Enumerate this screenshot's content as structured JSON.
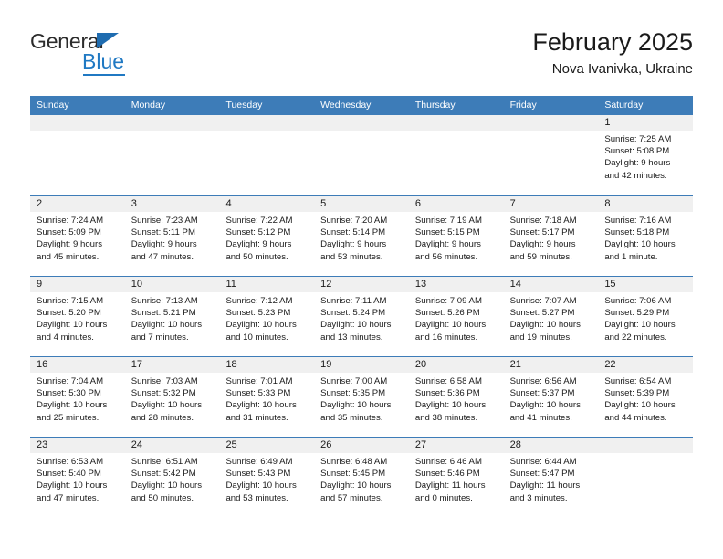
{
  "brand": {
    "name_part1": "General",
    "name_part2": "Blue",
    "triangle_color": "#1f6cb0",
    "blue_color": "#2079c3"
  },
  "header": {
    "title": "February 2025",
    "subtitle": "Nova Ivanivka, Ukraine"
  },
  "theme": {
    "header_blue": "#3d7cb8",
    "day_band_gray": "#f0f0f0",
    "text_color": "#1a1a1a"
  },
  "weekdays": [
    "Sunday",
    "Monday",
    "Tuesday",
    "Wednesday",
    "Thursday",
    "Friday",
    "Saturday"
  ],
  "weeks": [
    [
      {
        "day": "",
        "sunrise": "",
        "sunset": "",
        "daylight_line1": "",
        "daylight_line2": ""
      },
      {
        "day": "",
        "sunrise": "",
        "sunset": "",
        "daylight_line1": "",
        "daylight_line2": ""
      },
      {
        "day": "",
        "sunrise": "",
        "sunset": "",
        "daylight_line1": "",
        "daylight_line2": ""
      },
      {
        "day": "",
        "sunrise": "",
        "sunset": "",
        "daylight_line1": "",
        "daylight_line2": ""
      },
      {
        "day": "",
        "sunrise": "",
        "sunset": "",
        "daylight_line1": "",
        "daylight_line2": ""
      },
      {
        "day": "",
        "sunrise": "",
        "sunset": "",
        "daylight_line1": "",
        "daylight_line2": ""
      },
      {
        "day": "1",
        "sunrise": "Sunrise: 7:25 AM",
        "sunset": "Sunset: 5:08 PM",
        "daylight_line1": "Daylight: 9 hours",
        "daylight_line2": "and 42 minutes."
      }
    ],
    [
      {
        "day": "2",
        "sunrise": "Sunrise: 7:24 AM",
        "sunset": "Sunset: 5:09 PM",
        "daylight_line1": "Daylight: 9 hours",
        "daylight_line2": "and 45 minutes."
      },
      {
        "day": "3",
        "sunrise": "Sunrise: 7:23 AM",
        "sunset": "Sunset: 5:11 PM",
        "daylight_line1": "Daylight: 9 hours",
        "daylight_line2": "and 47 minutes."
      },
      {
        "day": "4",
        "sunrise": "Sunrise: 7:22 AM",
        "sunset": "Sunset: 5:12 PM",
        "daylight_line1": "Daylight: 9 hours",
        "daylight_line2": "and 50 minutes."
      },
      {
        "day": "5",
        "sunrise": "Sunrise: 7:20 AM",
        "sunset": "Sunset: 5:14 PM",
        "daylight_line1": "Daylight: 9 hours",
        "daylight_line2": "and 53 minutes."
      },
      {
        "day": "6",
        "sunrise": "Sunrise: 7:19 AM",
        "sunset": "Sunset: 5:15 PM",
        "daylight_line1": "Daylight: 9 hours",
        "daylight_line2": "and 56 minutes."
      },
      {
        "day": "7",
        "sunrise": "Sunrise: 7:18 AM",
        "sunset": "Sunset: 5:17 PM",
        "daylight_line1": "Daylight: 9 hours",
        "daylight_line2": "and 59 minutes."
      },
      {
        "day": "8",
        "sunrise": "Sunrise: 7:16 AM",
        "sunset": "Sunset: 5:18 PM",
        "daylight_line1": "Daylight: 10 hours",
        "daylight_line2": "and 1 minute."
      }
    ],
    [
      {
        "day": "9",
        "sunrise": "Sunrise: 7:15 AM",
        "sunset": "Sunset: 5:20 PM",
        "daylight_line1": "Daylight: 10 hours",
        "daylight_line2": "and 4 minutes."
      },
      {
        "day": "10",
        "sunrise": "Sunrise: 7:13 AM",
        "sunset": "Sunset: 5:21 PM",
        "daylight_line1": "Daylight: 10 hours",
        "daylight_line2": "and 7 minutes."
      },
      {
        "day": "11",
        "sunrise": "Sunrise: 7:12 AM",
        "sunset": "Sunset: 5:23 PM",
        "daylight_line1": "Daylight: 10 hours",
        "daylight_line2": "and 10 minutes."
      },
      {
        "day": "12",
        "sunrise": "Sunrise: 7:11 AM",
        "sunset": "Sunset: 5:24 PM",
        "daylight_line1": "Daylight: 10 hours",
        "daylight_line2": "and 13 minutes."
      },
      {
        "day": "13",
        "sunrise": "Sunrise: 7:09 AM",
        "sunset": "Sunset: 5:26 PM",
        "daylight_line1": "Daylight: 10 hours",
        "daylight_line2": "and 16 minutes."
      },
      {
        "day": "14",
        "sunrise": "Sunrise: 7:07 AM",
        "sunset": "Sunset: 5:27 PM",
        "daylight_line1": "Daylight: 10 hours",
        "daylight_line2": "and 19 minutes."
      },
      {
        "day": "15",
        "sunrise": "Sunrise: 7:06 AM",
        "sunset": "Sunset: 5:29 PM",
        "daylight_line1": "Daylight: 10 hours",
        "daylight_line2": "and 22 minutes."
      }
    ],
    [
      {
        "day": "16",
        "sunrise": "Sunrise: 7:04 AM",
        "sunset": "Sunset: 5:30 PM",
        "daylight_line1": "Daylight: 10 hours",
        "daylight_line2": "and 25 minutes."
      },
      {
        "day": "17",
        "sunrise": "Sunrise: 7:03 AM",
        "sunset": "Sunset: 5:32 PM",
        "daylight_line1": "Daylight: 10 hours",
        "daylight_line2": "and 28 minutes."
      },
      {
        "day": "18",
        "sunrise": "Sunrise: 7:01 AM",
        "sunset": "Sunset: 5:33 PM",
        "daylight_line1": "Daylight: 10 hours",
        "daylight_line2": "and 31 minutes."
      },
      {
        "day": "19",
        "sunrise": "Sunrise: 7:00 AM",
        "sunset": "Sunset: 5:35 PM",
        "daylight_line1": "Daylight: 10 hours",
        "daylight_line2": "and 35 minutes."
      },
      {
        "day": "20",
        "sunrise": "Sunrise: 6:58 AM",
        "sunset": "Sunset: 5:36 PM",
        "daylight_line1": "Daylight: 10 hours",
        "daylight_line2": "and 38 minutes."
      },
      {
        "day": "21",
        "sunrise": "Sunrise: 6:56 AM",
        "sunset": "Sunset: 5:37 PM",
        "daylight_line1": "Daylight: 10 hours",
        "daylight_line2": "and 41 minutes."
      },
      {
        "day": "22",
        "sunrise": "Sunrise: 6:54 AM",
        "sunset": "Sunset: 5:39 PM",
        "daylight_line1": "Daylight: 10 hours",
        "daylight_line2": "and 44 minutes."
      }
    ],
    [
      {
        "day": "23",
        "sunrise": "Sunrise: 6:53 AM",
        "sunset": "Sunset: 5:40 PM",
        "daylight_line1": "Daylight: 10 hours",
        "daylight_line2": "and 47 minutes."
      },
      {
        "day": "24",
        "sunrise": "Sunrise: 6:51 AM",
        "sunset": "Sunset: 5:42 PM",
        "daylight_line1": "Daylight: 10 hours",
        "daylight_line2": "and 50 minutes."
      },
      {
        "day": "25",
        "sunrise": "Sunrise: 6:49 AM",
        "sunset": "Sunset: 5:43 PM",
        "daylight_line1": "Daylight: 10 hours",
        "daylight_line2": "and 53 minutes."
      },
      {
        "day": "26",
        "sunrise": "Sunrise: 6:48 AM",
        "sunset": "Sunset: 5:45 PM",
        "daylight_line1": "Daylight: 10 hours",
        "daylight_line2": "and 57 minutes."
      },
      {
        "day": "27",
        "sunrise": "Sunrise: 6:46 AM",
        "sunset": "Sunset: 5:46 PM",
        "daylight_line1": "Daylight: 11 hours",
        "daylight_line2": "and 0 minutes."
      },
      {
        "day": "28",
        "sunrise": "Sunrise: 6:44 AM",
        "sunset": "Sunset: 5:47 PM",
        "daylight_line1": "Daylight: 11 hours",
        "daylight_line2": "and 3 minutes."
      },
      {
        "day": "",
        "sunrise": "",
        "sunset": "",
        "daylight_line1": "",
        "daylight_line2": ""
      }
    ]
  ]
}
